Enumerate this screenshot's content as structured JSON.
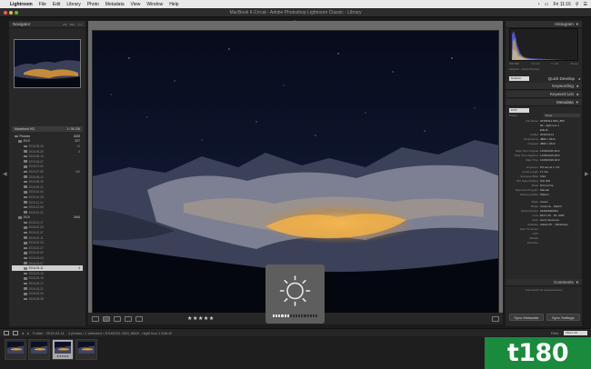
{
  "menubar": {
    "apple": "",
    "items": [
      "Lightroom",
      "File",
      "Edit",
      "Library",
      "Photo",
      "Metadata",
      "View",
      "Window",
      "Help"
    ],
    "clock": "Fri 11:16"
  },
  "window": {
    "title": "MacBook II-2.lrcat - Adobe Photoshop Lightroom Classic - Library",
    "traffic_colors": [
      "#fc5b57",
      "#e5bf3c",
      "#57c038"
    ]
  },
  "left_panel": {
    "navigator_label": "Navigator",
    "navigator_zoom": [
      "FIT",
      "FILL",
      "1:1"
    ],
    "folders_header": "Macintosh HD",
    "folders_header_size": "1 / 50 GB",
    "folders": [
      {
        "name": "Pictures",
        "count": "3025",
        "kind": "root"
      },
      {
        "name": "2015",
        "count": "627",
        "kind": "year"
      },
      {
        "name": "2015-05-26",
        "count": "24",
        "kind": "date"
      },
      {
        "name": "2015-05-29",
        "count": "8",
        "kind": "date"
      },
      {
        "name": "2015-06-14",
        "count": "",
        "kind": "date"
      },
      {
        "name": "2015-06-27",
        "count": "",
        "kind": "date"
      },
      {
        "name": "2015-07-02",
        "count": "",
        "kind": "date"
      },
      {
        "name": "2015-07-05",
        "count": "146",
        "kind": "date"
      },
      {
        "name": "2015-08-12",
        "count": "",
        "kind": "date"
      },
      {
        "name": "2015-08-30",
        "count": "",
        "kind": "date"
      },
      {
        "name": "2015-09-21",
        "count": "",
        "kind": "date"
      },
      {
        "name": "2015-10-04",
        "count": "",
        "kind": "date"
      },
      {
        "name": "2015-10-28",
        "count": "",
        "kind": "date"
      },
      {
        "name": "2015-11-14",
        "count": "",
        "kind": "date"
      },
      {
        "name": "2015-12-09",
        "count": "",
        "kind": "date"
      },
      {
        "name": "2015-12-21",
        "count": "",
        "kind": "date"
      },
      {
        "name": "2016",
        "count": "2466",
        "kind": "year"
      },
      {
        "name": "2016-01-17",
        "count": "",
        "kind": "date"
      },
      {
        "name": "2016-02-03",
        "count": "",
        "kind": "date"
      },
      {
        "name": "2016-02-07",
        "count": "",
        "kind": "date"
      },
      {
        "name": "2016-02-11",
        "count": "",
        "kind": "date"
      },
      {
        "name": "2016-02-23",
        "count": "",
        "kind": "date"
      },
      {
        "name": "2016-02-27",
        "count": "",
        "kind": "date"
      },
      {
        "name": "2016-03-02",
        "count": "",
        "kind": "date"
      },
      {
        "name": "2016-03-04",
        "count": "",
        "kind": "date"
      },
      {
        "name": "2016-03-07",
        "count": "",
        "kind": "date"
      },
      {
        "name": "2016-03-11",
        "count": "4",
        "kind": "selected"
      },
      {
        "name": "2016-03-13",
        "count": "",
        "kind": "date"
      },
      {
        "name": "2016-03-15",
        "count": "",
        "kind": "date"
      },
      {
        "name": "2016-03-17",
        "count": "",
        "kind": "date"
      },
      {
        "name": "2016-03-21",
        "count": "",
        "kind": "date"
      },
      {
        "name": "2016-03-24",
        "count": "",
        "kind": "date"
      },
      {
        "name": "2016-03-28",
        "count": "",
        "kind": "date"
      }
    ],
    "import_label": "Import...",
    "export_label": "Export..."
  },
  "toolbar": {
    "stars": "★★★★★"
  },
  "brightness_overlay": {
    "level": 0.35
  },
  "right_panel": {
    "histogram_label": "Histogram",
    "histogram_meta": [
      "ISO 800",
      "14 mm",
      "f / 2.8",
      "15 sec"
    ],
    "original_preview": "Original + Smart Preview",
    "quick_develop_preset": "Defaults",
    "quick_develop_label": "Quick Develop",
    "keywording_label": "Keywording",
    "keyword_list_label": "Keyword List",
    "metadata_label": "Metadata",
    "metadata_select": "EXIF",
    "preset_label": "Preset",
    "preset_value": "None",
    "metadata_rows": [
      {
        "k": "File Name",
        "v": "20160311-SD3_869"
      },
      {
        "k": "",
        "v": "69 - night tour 1"
      },
      {
        "k": "",
        "v": "Edit.tif"
      },
      {
        "k": "Folder",
        "v": "2016-03-11"
      },
      {
        "k": "Dimensions",
        "v": "4882 x 3214"
      },
      {
        "k": "Cropped",
        "v": "4882 x 3214"
      },
      {
        "k": "gap",
        "v": ""
      },
      {
        "k": "Date Time Original",
        "v": "11/03/2016 20:0"
      },
      {
        "k": "Date Time Digitized",
        "v": "11/03/2016 20:0"
      },
      {
        "k": "Date Time",
        "v": "11/03/2016 20:0"
      },
      {
        "k": "gap",
        "v": ""
      },
      {
        "k": "Exposure",
        "v": "8.0 sec at f / 4.0"
      },
      {
        "k": "Focal Length",
        "v": "17 mm"
      },
      {
        "k": "Exposure Bias",
        "v": "0 EV"
      },
      {
        "k": "ISO Speed Rating",
        "v": "ISO 400"
      },
      {
        "k": "Flash",
        "v": "Did not fire"
      },
      {
        "k": "Exposure Program",
        "v": "Manual"
      },
      {
        "k": "Metering Mode",
        "v": "Pattern"
      },
      {
        "k": "gap",
        "v": ""
      },
      {
        "k": "Make",
        "v": "Canon"
      },
      {
        "k": "Model",
        "v": "Canon E... Mark II"
      },
      {
        "k": "Serial Number",
        "v": "043023000404"
      },
      {
        "k": "Lens",
        "v": "EF17-40... /4L USM"
      },
      {
        "k": "Artist",
        "v": "Harry Guinness"
      },
      {
        "k": "Software",
        "v": "Adobe Ph... (Windows)"
      },
      {
        "k": "User Comment",
        "v": ""
      },
      {
        "k": "GPS",
        "v": ""
      },
      {
        "k": "Altitude",
        "v": ""
      },
      {
        "k": "Direction",
        "v": ""
      }
    ],
    "comments_label": "Comments",
    "comments_note": "Comments not supported here",
    "sync_metadata": "Sync Metadata",
    "sync_settings": "Sync Settings"
  },
  "filmstrip_bar": {
    "folder_text": "Folder : 2016-03-11",
    "count_text": "4 photos / 1 selected / 20160311-SD3_8869 - night tour 1 Edit.tif",
    "filter_label": "Filter :",
    "filter_value": "Filters Off"
  },
  "filmstrip": {
    "thumbs": [
      {
        "stars": "",
        "selected": false
      },
      {
        "stars": "",
        "selected": false
      },
      {
        "stars": "★★★★★",
        "selected": true
      },
      {
        "stars": "",
        "selected": false
      }
    ]
  },
  "watermark": "t180"
}
